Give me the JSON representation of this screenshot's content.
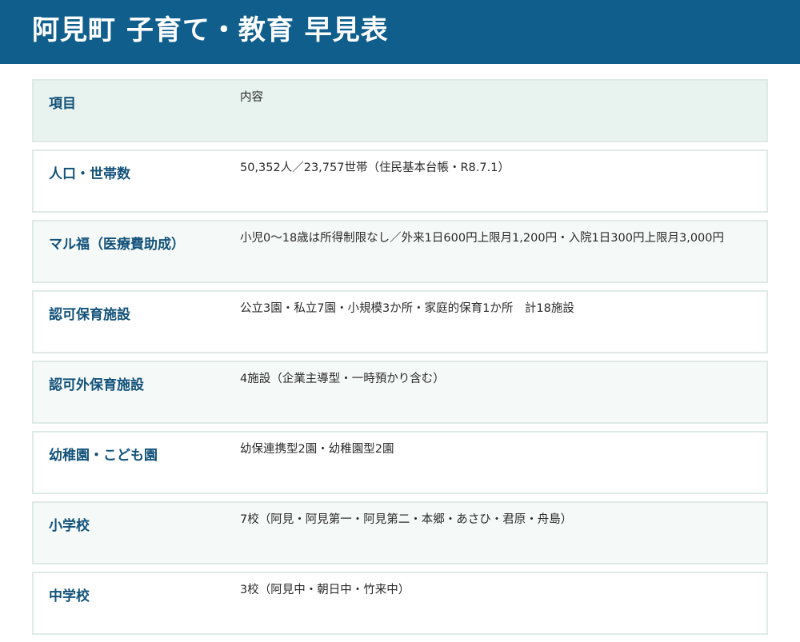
{
  "header": {
    "title": "阿見町 子育て・教育 早見表"
  },
  "table": {
    "rows": [
      {
        "key": "項目",
        "value": "内容"
      },
      {
        "key": "人口・世帯数",
        "value": "50,352人／23,757世帯（住民基本台帳・R8.7.1）"
      },
      {
        "key": "マル福（医療費助成）",
        "value": "小児0〜18歳は所得制限なし／外来1日600円上限月1,200円・入院1日300円上限月3,000円"
      },
      {
        "key": "認可保育施設",
        "value": "公立3園・私立7園・小規模3か所・家庭的保育1か所　計18施設"
      },
      {
        "key": "認可外保育施設",
        "value": "4施設（企業主導型・一時預かり含む）"
      },
      {
        "key": "幼稚園・こども園",
        "value": "幼保連携型2園・幼稚園型2園"
      },
      {
        "key": "小学校",
        "value": "7校（阿見・阿見第一・阿見第二・本郷・あさひ・君原・舟島）"
      },
      {
        "key": "中学校",
        "value": "3校（阿見中・朝日中・竹来中）"
      }
    ]
  }
}
